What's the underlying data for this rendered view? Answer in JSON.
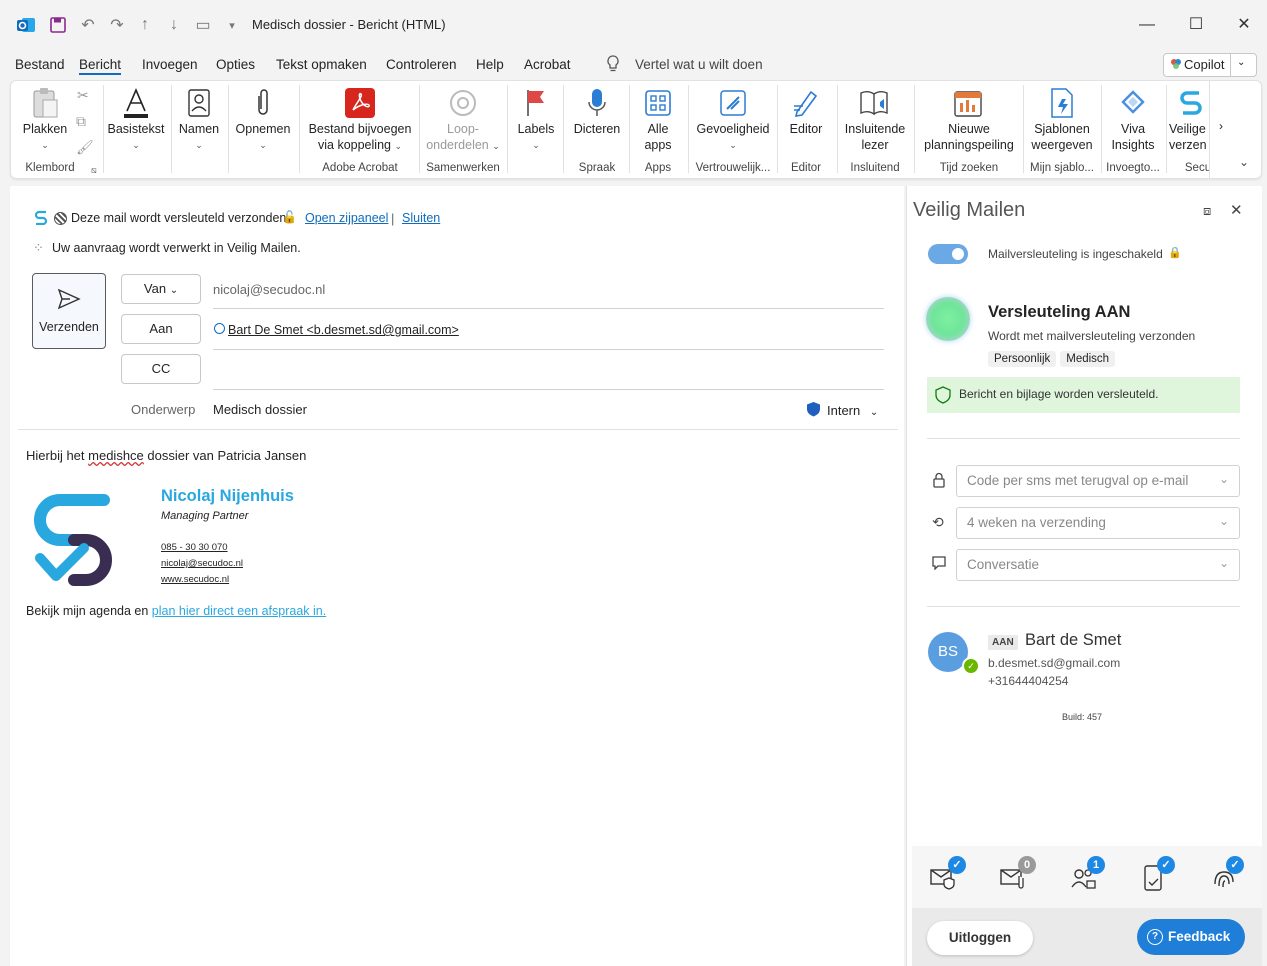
{
  "window": {
    "title": "Medisch dossier  -  Bericht (HTML)",
    "menu": [
      "Bestand",
      "Bericht",
      "Invoegen",
      "Opties",
      "Tekst opmaken",
      "Controleren",
      "Help",
      "Acrobat"
    ],
    "search_placeholder": "Vertel wat u wilt doen",
    "copilot_label": "Copilot"
  },
  "ribbon": {
    "plakken": "Plakken",
    "basistekst": "Basistekst",
    "namen": "Namen",
    "opnemen": "Opnemen",
    "bestand_bijvoegen_1": "Bestand bijvoegen",
    "bestand_bijvoegen_2": "via koppeling",
    "loop_1": "Loop-",
    "loop_2": "onderdelen",
    "labels": "Labels",
    "dicteren": "Dicteren",
    "alle_apps_1": "Alle",
    "alle_apps_2": "apps",
    "gevoeligheid": "Gevoeligheid",
    "editor": "Editor",
    "insluitende_1": "Insluitende",
    "insluitende_2": "lezer",
    "nieuwe_1": "Nieuwe",
    "nieuwe_2": "planningspeiling",
    "sjablonen_1": "Sjablonen",
    "sjablonen_2": "weergeven",
    "viva_1": "Viva",
    "viva_2": "Insights",
    "veilig_1": "Veilige",
    "veilig_2": "verzen",
    "groups": {
      "klembord": "Klembord",
      "adobe": "Adobe Acrobat",
      "samenwerken": "Samenwerken",
      "spraak": "Spraak",
      "apps": "Apps",
      "vertrouwelijk": "Vertrouwelijk...",
      "editor": "Editor",
      "insluitend": "Insluitend",
      "tijd": "Tijd zoeken",
      "mijn_sjablo": "Mijn sjablo...",
      "invoegto": "Invoegto...",
      "secu": "Secu"
    }
  },
  "compose": {
    "encryption_notice": "Deze mail wordt versleuteld verzonden.",
    "open_panel": "Open zijpaneel",
    "divider": "|",
    "close": "Sluiten",
    "processing": "Uw aanvraag wordt verwerkt in Veilig Mailen.",
    "send_label": "Verzenden",
    "from_label": "Van",
    "from_value": "nicolaj@secudoc.nl",
    "to_label": "Aan",
    "to_value": "Bart De Smet <b.desmet.sd@gmail.com>",
    "cc_label": "CC",
    "subject_label": "Onderwerp",
    "subject_value": "Medisch dossier",
    "sensitivity": "Intern",
    "body_prefix": "Hierbij het ",
    "body_misspelled": "medishce",
    "body_suffix": " dossier van Patricia Jansen",
    "signature": {
      "name": "Nicolaj Nijenhuis",
      "role": "Managing Partner",
      "phone": "085 - 30 30 070",
      "email": "nicolaj@secudoc.nl",
      "web": "www.secudoc.nl"
    },
    "agenda_prefix": "Bekijk mijn agenda en ",
    "agenda_link": "plan hier direct een afspraak in."
  },
  "panel": {
    "title": "Veilig Mailen",
    "toggle_label": "Mailversleuteling is ingeschakeld",
    "status_title": "Versleuteling AAN",
    "status_sub": "Wordt met mailversleuteling verzonden",
    "tags": [
      "Persoonlijk",
      "Medisch"
    ],
    "success": "Bericht en bijlage worden versleuteld.",
    "option_auth": "Code per sms met terugval op e-mail",
    "option_expiry": "4 weken na verzending",
    "option_mode": "Conversatie",
    "recipient": {
      "initials": "BS",
      "tag": "AAN",
      "name": "Bart de Smet",
      "email": "b.desmet.sd@gmail.com",
      "phone": "+31644404254"
    },
    "build": "Build: 457",
    "badges": [
      "",
      "0",
      "1",
      "",
      ""
    ],
    "logout": "Uitloggen",
    "feedback": "Feedback"
  },
  "colors": {
    "accent": "#0f6cbd",
    "success_bg": "#dff6dd",
    "badge_blue": "#1e88e5",
    "feedback_bg": "#1e7ed8",
    "logo_blue": "#29a8e0",
    "logo_dark": "#3a2d52"
  }
}
